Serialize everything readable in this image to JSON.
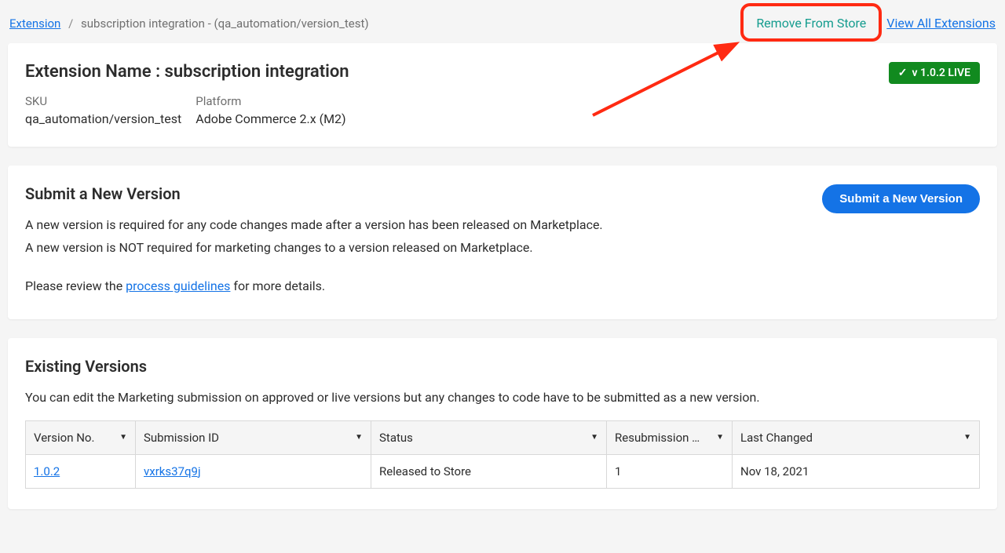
{
  "breadcrumb": {
    "root": "Extension",
    "current": "subscription integration - (qa_automation/version_test)"
  },
  "topActions": {
    "remove": "Remove From Store",
    "viewAll": "View All Extensions"
  },
  "header": {
    "titlePrefix": "Extension Name : ",
    "name": "subscription integration",
    "skuLabel": "SKU",
    "skuValue": "qa_automation/version_test",
    "platformLabel": "Platform",
    "platformValue": "Adobe Commerce 2.x (M2)",
    "liveBadge": "v 1.0.2 LIVE"
  },
  "submit": {
    "title": "Submit a New Version",
    "button": "Submit a New Version",
    "line1": "A new version is required for any code changes made after a version has been released on Marketplace.",
    "line2": "A new version is NOT required for marketing changes to a version released on Marketplace.",
    "reviewPrefix": "Please review the ",
    "guidelinesLink": "process guidelines",
    "reviewSuffix": " for more details."
  },
  "existing": {
    "title": "Existing Versions",
    "desc": "You can edit the Marketing submission on approved or live versions but any changes to code have to be submitted as a new version.",
    "columns": {
      "version": "Version No.",
      "submission": "Submission ID",
      "status": "Status",
      "resub": "Resubmission …",
      "changed": "Last Changed"
    },
    "rows": [
      {
        "version": "1.0.2",
        "submission": "vxrks37q9j",
        "status": "Released to Store",
        "resub": "1",
        "changed": "Nov 18, 2021"
      }
    ]
  }
}
